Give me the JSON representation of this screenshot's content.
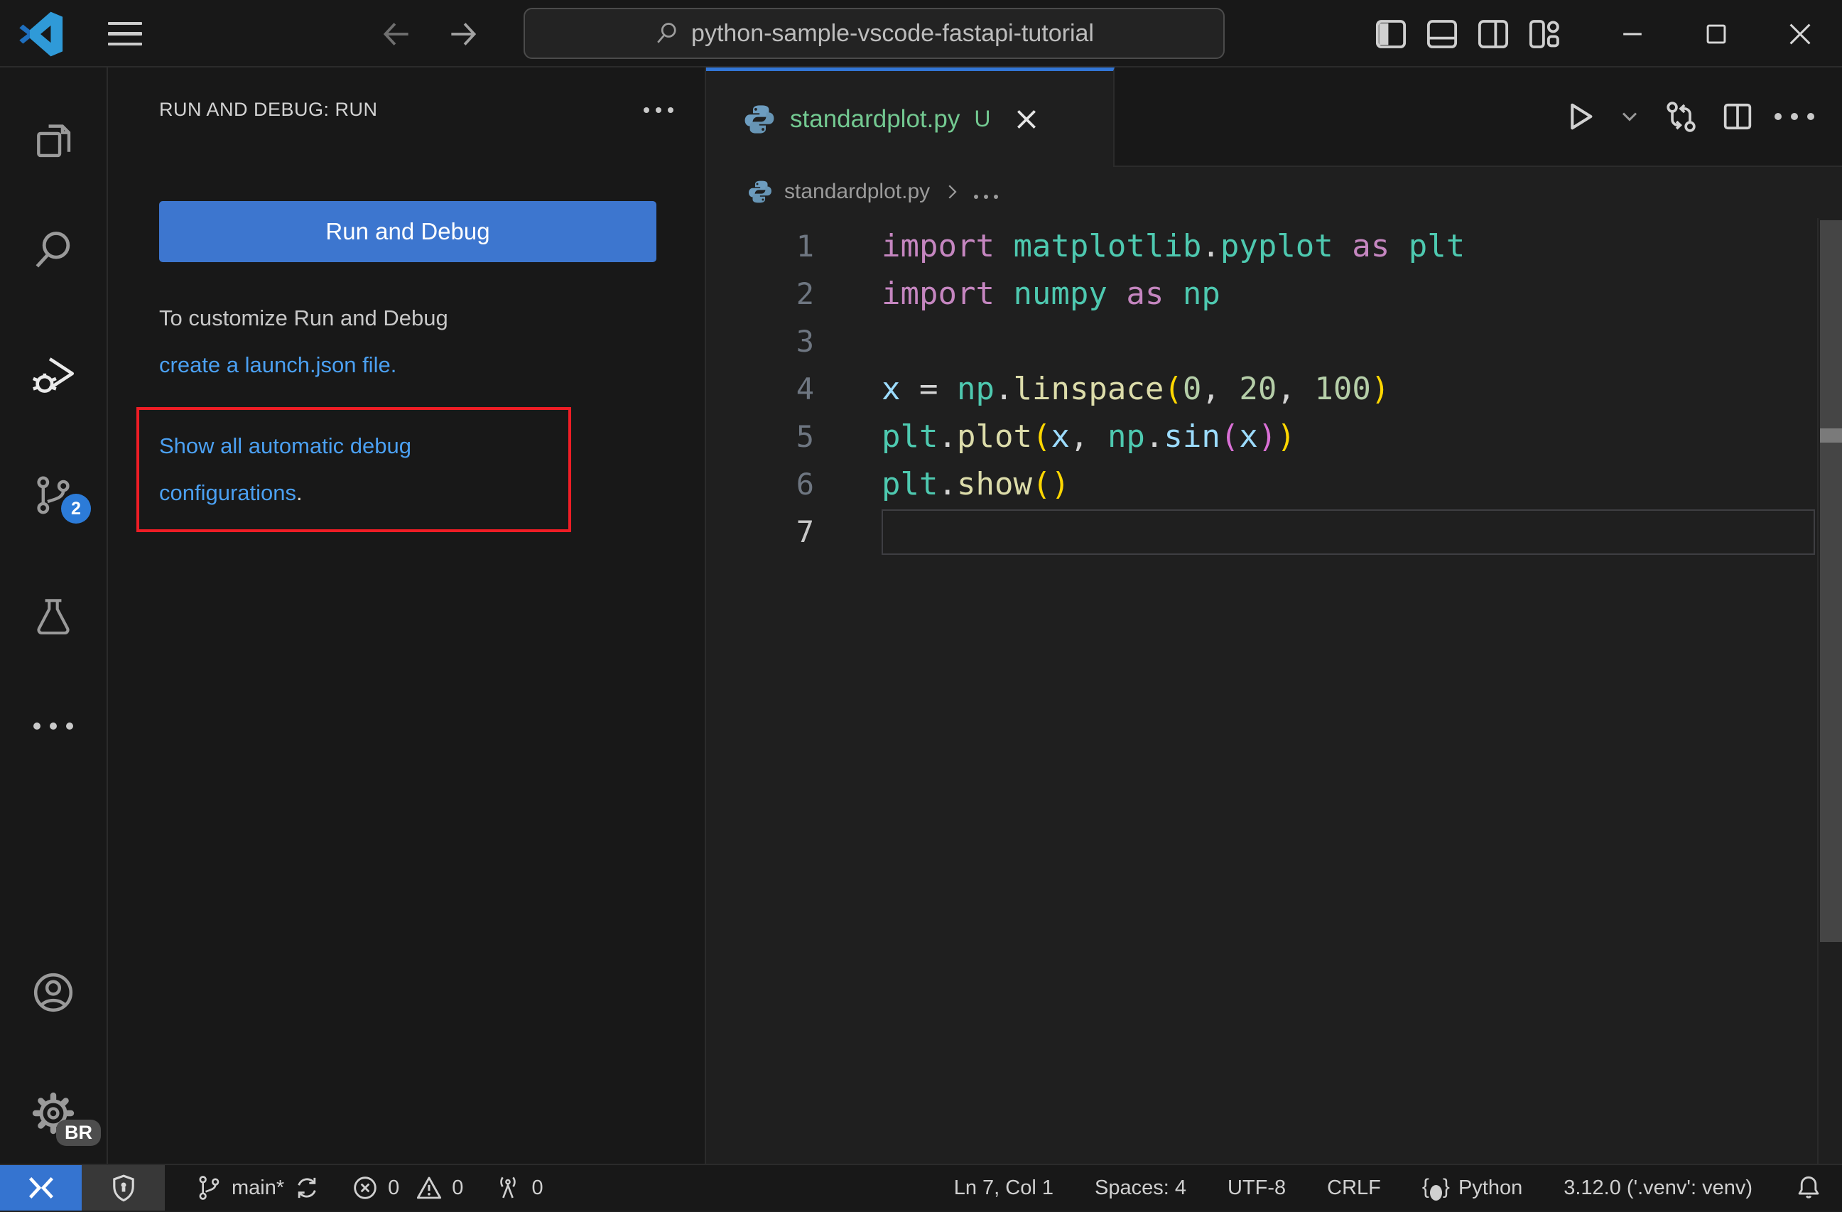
{
  "titlebar": {
    "search_value": "python-sample-vscode-fastapi-tutorial"
  },
  "activity_bar": {
    "scm_badge": "2",
    "profile_badge": "BR",
    "icons": [
      "explorer",
      "search",
      "run-and-debug",
      "source-control",
      "testing",
      "more",
      "account",
      "settings"
    ]
  },
  "sidebar": {
    "header_title": "RUN AND DEBUG: RUN",
    "run_button_label": "Run and Debug",
    "customize_line1": "To customize Run and Debug",
    "customize_link": "create a launch.json file.",
    "autoconfig_link": "Show all automatic debug configurations",
    "autoconfig_suffix": "."
  },
  "editor": {
    "tab": {
      "label": "standardplot.py",
      "modifier": "U"
    },
    "breadcrumb": {
      "file": "standardplot.py"
    },
    "toolbar_icons": [
      "run",
      "run-dropdown",
      "compare-changes",
      "split-editor",
      "more-actions"
    ],
    "code": {
      "cursor_line": 7,
      "colors": {
        "kw": "#C586C0",
        "mod": "#4EC9B0",
        "fn": "#DCDCAA",
        "var": "#9CDCFE",
        "num": "#B5CEA8",
        "pun": "#D4D4D4",
        "br1": "#FFD700",
        "br2": "#DA70D6"
      },
      "lines": [
        [
          {
            "t": "import ",
            "c": "kw"
          },
          {
            "t": "matplotlib",
            "c": "mod"
          },
          {
            "t": ".",
            "c": "pun"
          },
          {
            "t": "pyplot",
            "c": "mod"
          },
          {
            "t": " ",
            "c": "pun"
          },
          {
            "t": "as",
            "c": "kw"
          },
          {
            "t": " ",
            "c": "pun"
          },
          {
            "t": "plt",
            "c": "mod"
          }
        ],
        [
          {
            "t": "import ",
            "c": "kw"
          },
          {
            "t": "numpy",
            "c": "mod"
          },
          {
            "t": " ",
            "c": "pun"
          },
          {
            "t": "as",
            "c": "kw"
          },
          {
            "t": " ",
            "c": "pun"
          },
          {
            "t": "np",
            "c": "mod"
          }
        ],
        [],
        [
          {
            "t": "x",
            "c": "var"
          },
          {
            "t": " = ",
            "c": "pun"
          },
          {
            "t": "np",
            "c": "mod"
          },
          {
            "t": ".",
            "c": "pun"
          },
          {
            "t": "linspace",
            "c": "fn"
          },
          {
            "t": "(",
            "c": "br1"
          },
          {
            "t": "0",
            "c": "num"
          },
          {
            "t": ", ",
            "c": "pun"
          },
          {
            "t": "20",
            "c": "num"
          },
          {
            "t": ", ",
            "c": "pun"
          },
          {
            "t": "100",
            "c": "num"
          },
          {
            "t": ")",
            "c": "br1"
          }
        ],
        [
          {
            "t": "plt",
            "c": "mod"
          },
          {
            "t": ".",
            "c": "pun"
          },
          {
            "t": "plot",
            "c": "fn"
          },
          {
            "t": "(",
            "c": "br1"
          },
          {
            "t": "x",
            "c": "var"
          },
          {
            "t": ", ",
            "c": "pun"
          },
          {
            "t": "np",
            "c": "mod"
          },
          {
            "t": ".",
            "c": "pun"
          },
          {
            "t": "sin",
            "c": "var"
          },
          {
            "t": "(",
            "c": "br2"
          },
          {
            "t": "x",
            "c": "var"
          },
          {
            "t": ")",
            "c": "br2"
          },
          {
            "t": ")",
            "c": "br1"
          }
        ],
        [
          {
            "t": "plt",
            "c": "mod"
          },
          {
            "t": ".",
            "c": "pun"
          },
          {
            "t": "show",
            "c": "fn"
          },
          {
            "t": "(",
            "c": "br1"
          },
          {
            "t": ")",
            "c": "br1"
          }
        ],
        []
      ]
    }
  },
  "status_bar": {
    "branch": "main*",
    "errors": "0",
    "warnings": "0",
    "ports": "0",
    "cursor": "Ln 7, Col 1",
    "indent": "Spaces: 4",
    "encoding": "UTF-8",
    "eol": "CRLF",
    "language": "Python",
    "interpreter": "3.12.0 ('.venv': venv)",
    "icons": [
      "remote",
      "shield",
      "git-branch",
      "sync",
      "error",
      "warning",
      "radio-tower",
      "language-brackets",
      "bell"
    ]
  },
  "colors": {
    "editor_bg": "#1F1F1F",
    "chrome_bg": "#181818",
    "border": "#2B2B2B",
    "button_blue": "#3D76CF",
    "remote_blue": "#3574D0",
    "tab_indicator_blue": "#3276D6",
    "badge_blue": "#2C7BD8",
    "link_blue": "#4BA0F2",
    "untracked_green": "#73C991",
    "highlight_red": "#EE1D25"
  }
}
